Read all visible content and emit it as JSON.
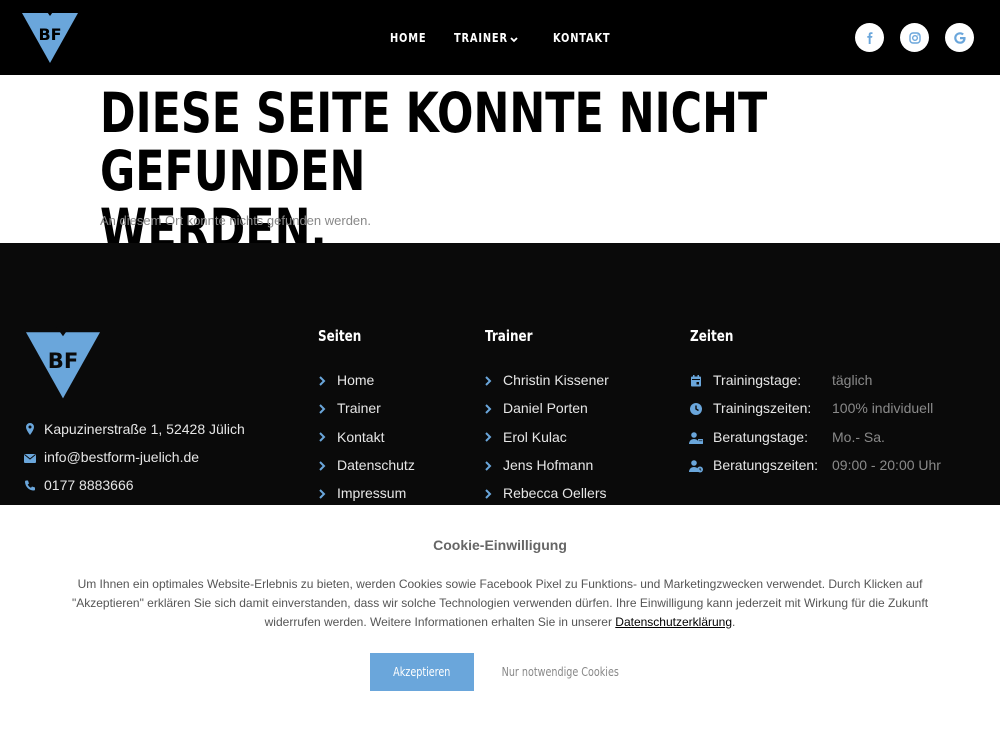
{
  "header": {
    "logo_alt": "BF",
    "nav": [
      {
        "label": "HOME"
      },
      {
        "label": "TRAINER"
      },
      {
        "label": "KONTAKT"
      }
    ],
    "social": [
      {
        "icon": "facebook-icon"
      },
      {
        "icon": "instagram-icon"
      },
      {
        "icon": "google-icon"
      }
    ],
    "social_color": "#6aa6db"
  },
  "main": {
    "title_line1": "DIESE SEITE KONNTE NICHT GEFUNDEN",
    "title_line2": "WERDEN.",
    "subtitle": "An diesem Ort konnte nichts gefunden werden."
  },
  "footer": {
    "contact": {
      "address": "Kapuzinerstraße 1, 52428 Jülich",
      "email": "info@bestform-juelich.de",
      "phone": "0177 8883666"
    },
    "seiten": {
      "heading": "Seiten",
      "links": [
        "Home",
        "Trainer",
        "Kontakt",
        "Datenschutz",
        "Impressum"
      ]
    },
    "trainer": {
      "heading": "Trainer",
      "links": [
        "Christin Kissener",
        "Daniel Porten",
        "Erol Kulac",
        "Jens Hofmann",
        "Rebecca Oellers"
      ]
    },
    "zeiten": {
      "heading": "Zeiten",
      "rows": [
        {
          "label": "Trainingstage:",
          "value": "täglich",
          "icon": "calendar-icon"
        },
        {
          "label": "Trainingszeiten:",
          "value": "100% individuell",
          "icon": "clock-icon"
        },
        {
          "label": "Beratungstage:",
          "value": "Mo.- Sa.",
          "icon": "user-calendar-icon"
        },
        {
          "label": "Beratungszeiten:",
          "value": "09:00 - 20:00 Uhr",
          "icon": "user-clock-icon"
        }
      ]
    },
    "accent": "#6aa6db"
  },
  "cookie": {
    "title": "Cookie-Einwilligung",
    "text": "Um Ihnen ein optimales Website-Erlebnis zu bieten, werden Cookies sowie Facebook Pixel zu Funktions- und Marketingzwecken verwendet. Durch Klicken auf \"Akzeptieren\" erklären Sie sich damit einverstanden, dass wir solche Technologien verwenden dürfen. Ihre Einwilligung kann jederzeit mit Wirkung für die Zukunft widerrufen werden. Weitere Informationen erhalten Sie in unserer ",
    "link": "Datenschutzerklärung",
    "text_end": ".",
    "accept": "Akzeptieren",
    "necessary": "Nur notwendige Cookies"
  }
}
